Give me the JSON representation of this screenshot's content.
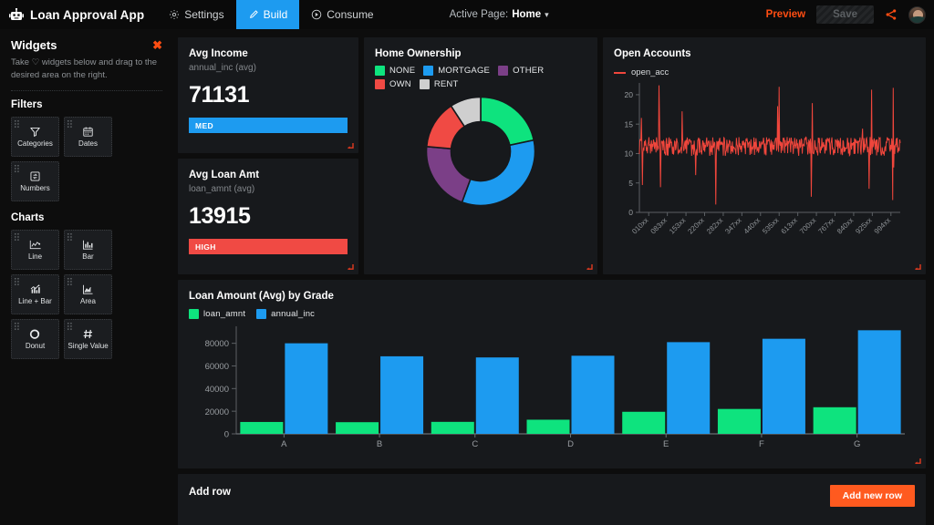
{
  "header": {
    "logo_icon": "robot-icon",
    "app_title": "Loan Approval App",
    "nav": [
      {
        "label": "Settings",
        "icon": "gear-icon",
        "active": false
      },
      {
        "label": "Build",
        "icon": "pencil-icon",
        "active": true
      },
      {
        "label": "Consume",
        "icon": "play-circle-icon",
        "active": false
      }
    ],
    "active_page_label": "Active Page:",
    "active_page_value": "Home",
    "caret_icon": "chevron-down-icon",
    "preview_label": "Preview",
    "save_label": "Save",
    "share_icon": "share-icon",
    "avatar_icon": "avatar",
    "accent_blue": "#1d9bf0",
    "accent_orange": "#ff4d12"
  },
  "sidebar": {
    "title": "Widgets",
    "close_icon": "close-icon",
    "description": "Take ♡ widgets below and drag to the desired area on the right.",
    "sections": [
      {
        "name": "Filters",
        "items": [
          {
            "label": "Categories",
            "icon": "funnel-icon"
          },
          {
            "label": "Dates",
            "icon": "calendar-icon"
          },
          {
            "label": "Numbers",
            "icon": "number-box-icon"
          }
        ]
      },
      {
        "name": "Charts",
        "items": [
          {
            "label": "Line",
            "icon": "line-chart-icon"
          },
          {
            "label": "Bar",
            "icon": "bar-chart-icon"
          },
          {
            "label": "Line + Bar",
            "icon": "line-bar-chart-icon"
          },
          {
            "label": "Area",
            "icon": "area-chart-icon"
          },
          {
            "label": "Donut",
            "icon": "donut-chart-icon"
          },
          {
            "label": "Single Value",
            "icon": "hash-icon"
          }
        ]
      }
    ]
  },
  "kpis": [
    {
      "title": "Avg Income",
      "subtitle": "annual_inc (avg)",
      "value": "71131",
      "badge_label": "MED",
      "badge_color": "#1d9bf0"
    },
    {
      "title": "Avg Loan Amt",
      "subtitle": "loan_amnt (avg)",
      "value": "13915",
      "badge_label": "HIGH",
      "badge_color": "#f04a44"
    }
  ],
  "chart_data": [
    {
      "type": "pie",
      "title": "Home Ownership",
      "legend_position": "top",
      "labels": [
        "NONE",
        "MORTGAGE",
        "OTHER",
        "OWN",
        "RENT"
      ],
      "values": [
        21.7,
        33.9,
        20.8,
        14.4,
        9.2
      ],
      "colors": [
        "#0ee37e",
        "#1d9bf0",
        "#7b3f87",
        "#f04a44",
        "#cfcfcf"
      ],
      "donut": true
    },
    {
      "type": "line",
      "title": "Open Accounts",
      "legend_position": "top",
      "series": [
        {
          "name": "open_acc",
          "color": "#f0463c"
        }
      ],
      "xlabel": "",
      "ylabel": "",
      "ylim": [
        0,
        22
      ],
      "yticks": [
        0,
        5,
        10,
        15,
        20
      ],
      "xticks": [
        "010xx",
        "083xx",
        "153xx",
        "220xx",
        "282xx",
        "347xx",
        "440xx",
        "535xx",
        "613xx",
        "700xx",
        "767xx",
        "840xx",
        "925xx",
        "994xx"
      ],
      "grid": false,
      "mean_level": 11.2,
      "noise_amplitude": 1.6,
      "spike_count": 60
    },
    {
      "type": "bar",
      "title": "Loan Amount (Avg) by Grade",
      "legend_position": "top",
      "categories": [
        "A",
        "B",
        "C",
        "D",
        "E",
        "F",
        "G"
      ],
      "series": [
        {
          "name": "loan_amnt",
          "color": "#0ee37e",
          "values": [
            10500,
            10300,
            10600,
            12500,
            19500,
            22000,
            23500
          ]
        },
        {
          "name": "annual_inc",
          "color": "#1d9bf0",
          "values": [
            80000,
            68500,
            67500,
            69000,
            81000,
            84000,
            91500
          ]
        }
      ],
      "xlabel": "",
      "ylabel": "",
      "ylim": [
        0,
        95000
      ],
      "yticks": [
        0,
        20000,
        40000,
        60000,
        80000
      ],
      "grid": false
    }
  ],
  "add_row": {
    "title": "Add row",
    "button_label": "Add new row",
    "button_color": "#ff5a1f"
  }
}
